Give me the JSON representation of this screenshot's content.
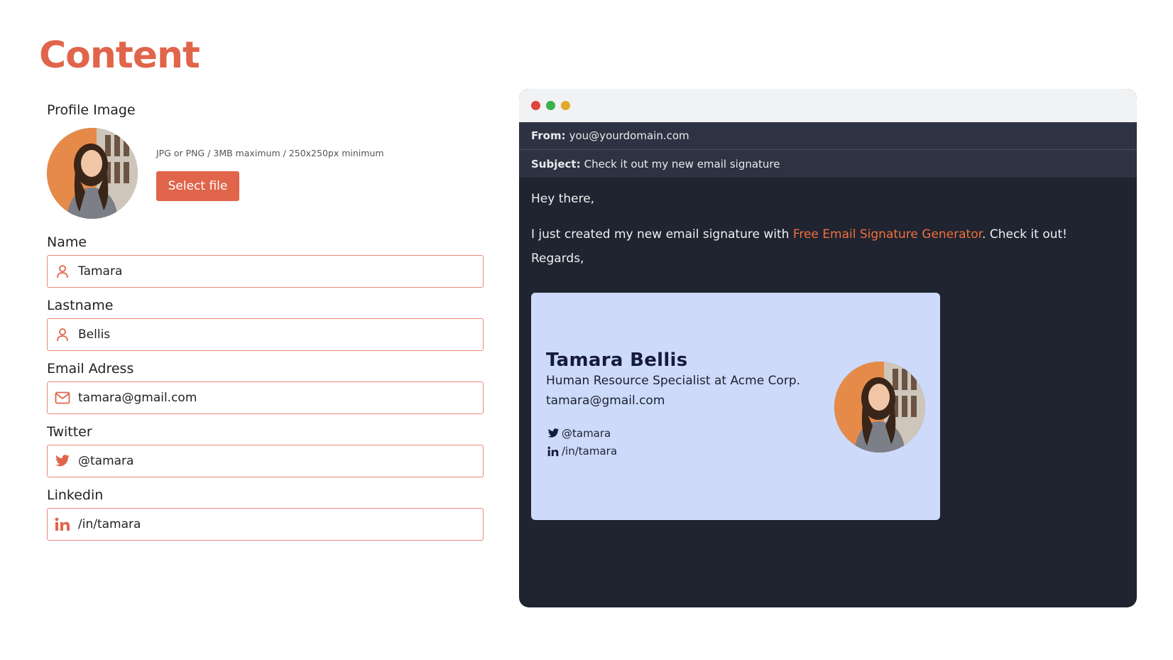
{
  "page": {
    "title": "Content"
  },
  "colors": {
    "accent": "#e0654a",
    "link": "#f26f3c",
    "window_bg": "#1f2430",
    "signature_bg": "#cddaf9"
  },
  "form": {
    "profile": {
      "label": "Profile Image",
      "hint": "JPG or PNG / 3MB maximum / 250x250px minimum",
      "button_label": "Select file"
    },
    "fields": [
      {
        "label": "Name",
        "value": "Tamara",
        "icon": "user-icon"
      },
      {
        "label": "Lastname",
        "value": "Bellis",
        "icon": "user-icon"
      },
      {
        "label": "Email Adress",
        "value": "tamara@gmail.com",
        "icon": "mail-icon"
      },
      {
        "label": "Twitter",
        "value": "@tamara",
        "icon": "twitter-icon"
      },
      {
        "label": "Linkedin",
        "value": "/in/tamara",
        "icon": "linkedin-icon"
      }
    ]
  },
  "email": {
    "from_label": "From:",
    "from_value": "you@yourdomain.com",
    "subject_label": "Subject:",
    "subject_value": "Check it out my new email signature",
    "greeting": "Hey there,",
    "intro_before": "I just created my new email signature with ",
    "intro_link": "Free Email Signature Generator",
    "intro_after": ". Check it out!",
    "closing": "Regards,"
  },
  "signature": {
    "name": "Tamara Bellis",
    "title": "Human Resource Specialist at Acme Corp.",
    "email": "tamara@gmail.com",
    "twitter": "@tamara",
    "linkedin": "/in/tamara"
  }
}
